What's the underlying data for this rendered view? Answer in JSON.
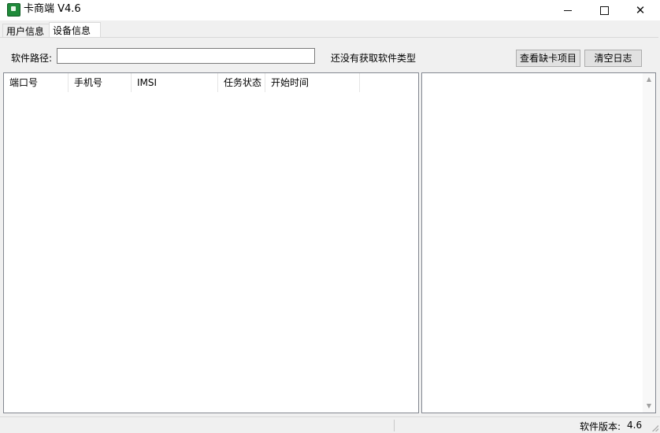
{
  "window": {
    "title": "卡商端 V4.6",
    "icon": "app-icon"
  },
  "tabs": [
    {
      "label": "用户信息",
      "active": false
    },
    {
      "label": "设备信息",
      "active": true
    }
  ],
  "toolbar": {
    "path_label": "软件路径:",
    "path_value": "",
    "status_text": "还没有获取软件类型",
    "missing_button": "查看缺卡项目",
    "clear_button": "清空日志"
  },
  "table": {
    "columns": [
      "端口号",
      "手机号",
      "IMSI",
      "任务状态",
      "开始时间"
    ],
    "rows": []
  },
  "statusbar": {
    "version_label": "软件版本:",
    "version_value": "4.6"
  }
}
